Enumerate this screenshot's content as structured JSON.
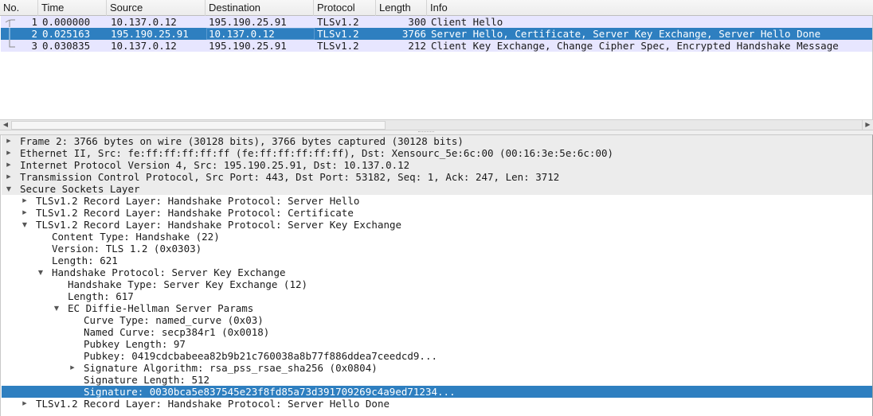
{
  "packet_list": {
    "columns": [
      "No.",
      "Time",
      "Source",
      "Destination",
      "Protocol",
      "Length",
      "Info"
    ],
    "rows": [
      {
        "no": "1",
        "time": "0.000000",
        "source": "10.137.0.12",
        "destination": "195.190.25.91",
        "protocol": "TLSv1.2",
        "length": "300",
        "info": "Client Hello",
        "selected": false
      },
      {
        "no": "2",
        "time": "0.025163",
        "source": "195.190.25.91",
        "destination": "10.137.0.12",
        "protocol": "TLSv1.2",
        "length": "3766",
        "info": "Server Hello, Certificate, Server Key Exchange, Server Hello Done",
        "selected": true
      },
      {
        "no": "3",
        "time": "0.030835",
        "source": "10.137.0.12",
        "destination": "195.190.25.91",
        "protocol": "TLSv1.2",
        "length": "212",
        "info": "Client Key Exchange, Change Cipher Spec, Encrypted Handshake Message",
        "selected": false
      }
    ]
  },
  "details": {
    "items": [
      {
        "text": "Frame 2: 3766 bytes on wire (30128 bits), 3766 bytes captured (30128 bits)",
        "level": 0,
        "toggle": "collapsed",
        "selected": false
      },
      {
        "text": "Ethernet II, Src: fe:ff:ff:ff:ff:ff (fe:ff:ff:ff:ff:ff), Dst: Xensourc_5e:6c:00 (00:16:3e:5e:6c:00)",
        "level": 0,
        "toggle": "collapsed",
        "selected": false
      },
      {
        "text": "Internet Protocol Version 4, Src: 195.190.25.91, Dst: 10.137.0.12",
        "level": 0,
        "toggle": "collapsed",
        "selected": false
      },
      {
        "text": "Transmission Control Protocol, Src Port: 443, Dst Port: 53182, Seq: 1, Ack: 247, Len: 3712",
        "level": 0,
        "toggle": "collapsed",
        "selected": false
      },
      {
        "text": "Secure Sockets Layer",
        "level": 0,
        "toggle": "expanded",
        "selected": false
      },
      {
        "text": "TLSv1.2 Record Layer: Handshake Protocol: Server Hello",
        "level": 1,
        "toggle": "collapsed",
        "selected": false
      },
      {
        "text": "TLSv1.2 Record Layer: Handshake Protocol: Certificate",
        "level": 1,
        "toggle": "collapsed",
        "selected": false
      },
      {
        "text": "TLSv1.2 Record Layer: Handshake Protocol: Server Key Exchange",
        "level": 1,
        "toggle": "expanded",
        "selected": false
      },
      {
        "text": "Content Type: Handshake (22)",
        "level": 2,
        "toggle": "none",
        "selected": false
      },
      {
        "text": "Version: TLS 1.2 (0x0303)",
        "level": 2,
        "toggle": "none",
        "selected": false
      },
      {
        "text": "Length: 621",
        "level": 2,
        "toggle": "none",
        "selected": false
      },
      {
        "text": "Handshake Protocol: Server Key Exchange",
        "level": 2,
        "toggle": "expanded",
        "selected": false
      },
      {
        "text": "Handshake Type: Server Key Exchange (12)",
        "level": 3,
        "toggle": "none",
        "selected": false
      },
      {
        "text": "Length: 617",
        "level": 3,
        "toggle": "none",
        "selected": false
      },
      {
        "text": "EC Diffie-Hellman Server Params",
        "level": 3,
        "toggle": "expanded",
        "selected": false
      },
      {
        "text": "Curve Type: named_curve (0x03)",
        "level": 4,
        "toggle": "none",
        "selected": false
      },
      {
        "text": "Named Curve: secp384r1 (0x0018)",
        "level": 4,
        "toggle": "none",
        "selected": false
      },
      {
        "text": "Pubkey Length: 97",
        "level": 4,
        "toggle": "none",
        "selected": false
      },
      {
        "text": "Pubkey: 0419cdcbabeea82b9b21c760038a8b77f886ddea7ceedcd9...",
        "level": 4,
        "toggle": "none",
        "selected": false
      },
      {
        "text": "Signature Algorithm: rsa_pss_rsae_sha256 (0x0804)",
        "level": 4,
        "toggle": "collapsed",
        "selected": false
      },
      {
        "text": "Signature Length: 512",
        "level": 4,
        "toggle": "none",
        "selected": false
      },
      {
        "text": "Signature: 0030bca5e837545e23f8fd85a73d391709269c4a9ed71234...",
        "level": 4,
        "toggle": "none",
        "selected": true
      },
      {
        "text": "TLSv1.2 Record Layer: Handshake Protocol: Server Hello Done",
        "level": 1,
        "toggle": "collapsed",
        "selected": false
      }
    ]
  },
  "icons": {
    "collapsed": "▶",
    "expanded": "▼",
    "scroll_left": "◀",
    "scroll_right": "▶"
  },
  "colors": {
    "selection": "#2e7fc0",
    "row_bg": "#e7e6ff",
    "top_level_bg": "#ececec"
  }
}
